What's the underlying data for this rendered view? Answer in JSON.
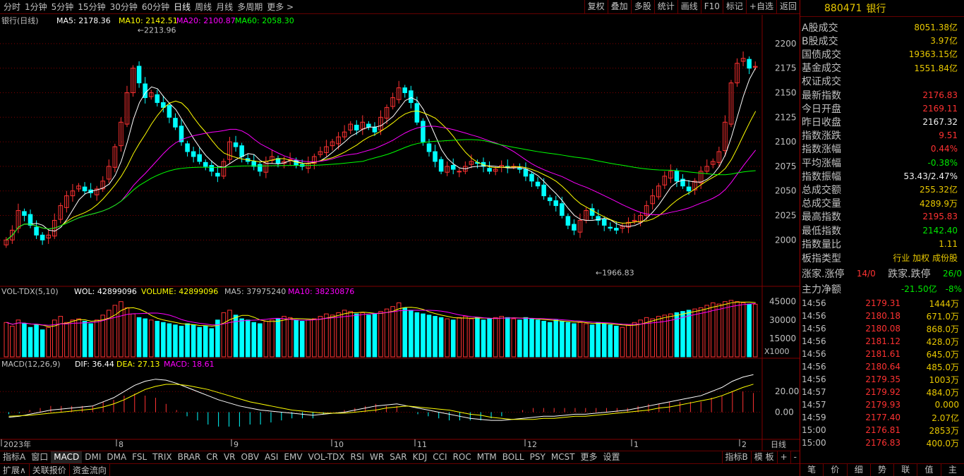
{
  "toolbar": {
    "periods": [
      "分时",
      "1分钟",
      "5分钟",
      "15分钟",
      "30分钟",
      "60分钟",
      "日线",
      "周线",
      "月线",
      "多周期",
      "更多 >"
    ],
    "active_period": "日线",
    "right_buttons": [
      "复权",
      "叠加",
      "多股",
      "统计",
      "画线",
      "F10",
      "标记",
      "+自选",
      "返回"
    ]
  },
  "chart": {
    "title": "银行(日线)",
    "ma5_label": "MA5: 2178.36",
    "ma10_label": "MA10: 2142.51",
    "ma20_label": "MA20: 2100.87",
    "ma60_label": "MA60: 2058.30",
    "max_label": "2213.96",
    "min_label": "1966.83",
    "price_ticks": [
      "2200",
      "2175",
      "2150",
      "2125",
      "2100",
      "2075",
      "2050",
      "2025",
      "2000"
    ],
    "vol_label_head": "VOL-TDX(5,10)",
    "vol_label_wol": "WOL: 42899096",
    "vol_label_volume": "VOLUME: 42899096",
    "vol_label_ma5": "MA5: 37975240",
    "vol_label_ma10": "MA10: 38230876",
    "vol_ticks": [
      "45000",
      "30000",
      "15000"
    ],
    "vol_unit": "X1000",
    "macd_label_head": "MACD(12,26,9)",
    "macd_label_dif": "DIF: 36.44",
    "macd_label_dea": "DEA: 27.13",
    "macd_label_macd": "MACD: 18.61",
    "macd_ticks": [
      "20.00",
      "0.00"
    ],
    "date_labels": [
      "2023年",
      "8",
      "9",
      "10",
      "11",
      "12",
      "1",
      "2"
    ],
    "period_label": "日线",
    "colors": {
      "up": "#ff3232",
      "down": "#00ffff",
      "ma5": "#ffffff",
      "ma10": "#ffff00",
      "ma20": "#ff00ff",
      "ma60": "#00ff00",
      "grid": "#800000"
    }
  },
  "chart_data": {
    "type": "candlestick",
    "title": "银行(日线)",
    "ylim": [
      1960,
      2215
    ],
    "closes": [
      2000,
      2010,
      2030,
      2025,
      2015,
      2005,
      2000,
      2005,
      2020,
      2035,
      2045,
      2050,
      2055,
      2050,
      2048,
      2052,
      2060,
      2075,
      2095,
      2120,
      2150,
      2175,
      2160,
      2145,
      2150,
      2140,
      2135,
      2125,
      2115,
      2100,
      2090,
      2085,
      2080,
      2075,
      2070,
      2065,
      2080,
      2100,
      2095,
      2085,
      2080,
      2075,
      2070,
      2080,
      2085,
      2078,
      2080,
      2082,
      2076,
      2075,
      2078,
      2085,
      2090,
      2095,
      2100,
      2105,
      2110,
      2118,
      2112,
      2120,
      2115,
      2110,
      2125,
      2135,
      2145,
      2155,
      2150,
      2140,
      2120,
      2100,
      2090,
      2080,
      2070,
      2075,
      2072,
      2070,
      2075,
      2080,
      2078,
      2075,
      2070,
      2072,
      2076,
      2074,
      2075,
      2072,
      2065,
      2060,
      2055,
      2045,
      2040,
      2035,
      2025,
      2015,
      2010,
      2020,
      2030,
      2025,
      2020,
      2015,
      2012,
      2010,
      2014,
      2018,
      2020,
      2025,
      2035,
      2045,
      2055,
      2065,
      2070,
      2060,
      2055,
      2050,
      2060,
      2070,
      2075,
      2080,
      2090,
      2120,
      2160,
      2180,
      2185,
      2175,
      2176.83
    ],
    "vol_values": [
      28,
      25,
      30,
      27,
      24,
      26,
      22,
      24,
      30,
      33,
      28,
      30,
      31,
      29,
      27,
      30,
      34,
      38,
      42,
      45,
      40,
      35,
      32,
      31,
      30,
      29,
      28,
      27,
      26,
      25,
      27,
      26,
      24,
      25,
      23,
      30,
      36,
      38,
      34,
      31,
      30,
      28,
      27,
      29,
      30,
      31,
      33,
      32,
      30,
      29,
      30,
      31,
      33,
      35,
      34,
      36,
      38,
      37,
      35,
      36,
      34,
      35,
      37,
      39,
      41,
      44,
      40,
      38,
      36,
      35,
      34,
      33,
      32,
      31,
      30,
      32,
      33,
      31,
      32,
      30,
      31,
      32,
      33,
      32,
      31,
      30,
      32,
      31,
      30,
      29,
      28,
      30,
      29,
      28,
      27,
      28,
      27,
      26,
      28,
      27,
      26,
      25,
      24,
      26,
      28,
      30,
      32,
      31,
      33,
      34,
      35,
      36,
      37,
      38,
      39,
      40,
      42,
      44,
      43,
      45,
      46,
      45,
      44,
      43,
      42.9
    ],
    "macd_dif": [
      -5,
      -4,
      -2,
      0,
      2,
      3,
      4,
      5,
      6,
      10,
      14,
      20,
      26,
      30,
      32,
      31,
      28,
      24,
      20,
      16,
      12,
      9,
      6,
      4,
      2,
      1,
      0,
      -1,
      -2,
      -3,
      -2,
      -1,
      0,
      2,
      4,
      6,
      7,
      8,
      6,
      4,
      2,
      0,
      -2,
      -4,
      -6,
      -7,
      -8,
      -8,
      -7,
      -6,
      -5,
      -4,
      -4,
      -3,
      -2,
      -2,
      -1,
      0,
      1,
      2,
      4,
      6,
      8,
      10,
      12,
      14,
      16,
      20,
      24,
      30,
      34,
      36.44
    ],
    "macd_dea": [
      -4,
      -3.5,
      -3,
      -2,
      -1,
      0,
      1,
      2,
      3,
      5,
      8,
      12,
      17,
      22,
      25,
      27,
      27,
      26,
      24,
      22,
      19,
      16,
      13,
      10,
      8,
      6,
      4,
      2,
      1,
      0,
      -1,
      -1,
      -1,
      0,
      1,
      2,
      4,
      5,
      6,
      5,
      4,
      3,
      2,
      0,
      -2,
      -3,
      -5,
      -6,
      -7,
      -7,
      -7,
      -6,
      -6,
      -5,
      -4,
      -4,
      -3,
      -2,
      -1,
      0,
      1,
      2,
      4,
      5,
      7,
      9,
      11,
      13,
      16,
      20,
      24,
      27.13
    ]
  },
  "side": {
    "code": "880471",
    "name": "银行",
    "rows": [
      {
        "k": "A股成交",
        "v": "8051.38亿",
        "c": "yel"
      },
      {
        "k": "B股成交",
        "v": "3.97亿",
        "c": "yel"
      },
      {
        "k": "国债成交",
        "v": "19363.15亿",
        "c": "yel"
      },
      {
        "k": "基金成交",
        "v": "1551.84亿",
        "c": "yel"
      },
      {
        "k": "权证成交",
        "v": "",
        "c": "yel"
      },
      {
        "k": "最新指数",
        "v": "2176.83",
        "c": "red"
      },
      {
        "k": "今日开盘",
        "v": "2169.11",
        "c": "red"
      },
      {
        "k": "昨日收盘",
        "v": "2167.32",
        "c": "wht"
      },
      {
        "k": "指数涨跌",
        "v": "9.51",
        "c": "red"
      },
      {
        "k": "指数涨幅",
        "v": "0.44%",
        "c": "red"
      },
      {
        "k": "平均涨幅",
        "v": "-0.38%",
        "c": "grn"
      },
      {
        "k": "指数振幅",
        "v": "53.43/2.47%",
        "c": "wht"
      },
      {
        "k": "总成交额",
        "v": "255.32亿",
        "c": "yel"
      },
      {
        "k": "总成交量",
        "v": "4289.9万",
        "c": "yel"
      },
      {
        "k": "最高指数",
        "v": "2195.83",
        "c": "red"
      },
      {
        "k": "最低指数",
        "v": "2142.40",
        "c": "grn"
      },
      {
        "k": "指数量比",
        "v": "1.11",
        "c": "yel"
      }
    ],
    "board_type_label": "板指类型",
    "board_type_value": "行业 加权 成份股",
    "up_limit_label": "涨家.涨停",
    "up_limit_value": "14/0",
    "down_limit_label": "跌家.跌停",
    "down_limit_value": "26/0",
    "main_fund_label": "主力净额",
    "main_fund_value": "-21.50亿",
    "main_fund_pct": "-8%",
    "trades": [
      {
        "t": "14:56",
        "p": "2179.31",
        "v": "1444万"
      },
      {
        "t": "14:56",
        "p": "2180.18",
        "v": "671.0万"
      },
      {
        "t": "14:56",
        "p": "2180.08",
        "v": "868.0万"
      },
      {
        "t": "14:56",
        "p": "2181.12",
        "v": "428.0万"
      },
      {
        "t": "14:56",
        "p": "2181.61",
        "v": "645.0万"
      },
      {
        "t": "14:56",
        "p": "2180.64",
        "v": "485.0万"
      },
      {
        "t": "14:56",
        "p": "2179.35",
        "v": "1003万"
      },
      {
        "t": "14:57",
        "p": "2179.92",
        "v": "484.0万"
      },
      {
        "t": "14:57",
        "p": "2179.93",
        "v": "0.000"
      },
      {
        "t": "14:59",
        "p": "2177.40",
        "v": "2.07亿"
      },
      {
        "t": "15:00",
        "p": "2176.81",
        "v": "2853万"
      },
      {
        "t": "15:00",
        "p": "2176.83",
        "v": "400.0万"
      }
    ],
    "tabs": [
      "笔",
      "价",
      "细",
      "势",
      "联",
      "值",
      "主"
    ]
  },
  "bottom": {
    "indicators": [
      "指标A",
      "窗口",
      "MACD",
      "DMI",
      "DMA",
      "FSL",
      "TRIX",
      "BRAR",
      "CR",
      "VR",
      "OBV",
      "ASI",
      "EMV",
      "VOL-TDX",
      "RSI",
      "WR",
      "SAR",
      "KDJ",
      "CCI",
      "ROC",
      "MTM",
      "BOLL",
      "PSY",
      "MCST",
      "更多",
      "设置"
    ],
    "active_indicator": "MACD",
    "right_items": [
      "指标B",
      "模 板",
      "+",
      "-"
    ],
    "row2": [
      "扩展∧",
      "关联报价",
      "资金流向"
    ]
  }
}
